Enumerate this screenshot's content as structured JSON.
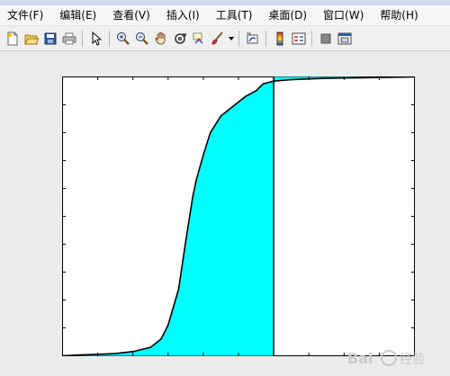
{
  "window": {
    "title_bar_color": "#cfdcec"
  },
  "menubar": {
    "items": [
      {
        "label": "文件(F)"
      },
      {
        "label": "编辑(E)"
      },
      {
        "label": "查看(V)"
      },
      {
        "label": "插入(I)"
      },
      {
        "label": "工具(T)"
      },
      {
        "label": "桌面(D)"
      },
      {
        "label": "窗口(W)"
      },
      {
        "label": "帮助(H)"
      }
    ]
  },
  "toolbar": {
    "icons": [
      "new-figure-icon",
      "open-file-icon",
      "save-icon",
      "print-icon",
      "select-arrow-icon",
      "zoom-in-icon",
      "zoom-out-icon",
      "pan-hand-icon",
      "rotate-3d-icon",
      "data-cursor-icon",
      "brush-icon",
      "brush-dropdown-icon",
      "link-plot-icon",
      "colorbar-icon",
      "legend-icon",
      "hide-plot-tools-icon",
      "show-plot-tools-icon"
    ]
  },
  "chart_data": {
    "type": "area",
    "description_free": true,
    "x": [
      0.0,
      0.05,
      0.1,
      0.15,
      0.2,
      0.25,
      0.28,
      0.3,
      0.33,
      0.35,
      0.37,
      0.38,
      0.4,
      0.42,
      0.45,
      0.48,
      0.5,
      0.52,
      0.55,
      0.57,
      0.6,
      0.61,
      0.63,
      0.65,
      0.7,
      0.75,
      0.8,
      0.85,
      0.9,
      0.95,
      1.0
    ],
    "y": [
      0.0,
      0.003,
      0.005,
      0.008,
      0.015,
      0.03,
      0.06,
      0.11,
      0.24,
      0.41,
      0.57,
      0.63,
      0.72,
      0.8,
      0.86,
      0.89,
      0.91,
      0.93,
      0.95,
      0.975,
      0.985,
      0.986,
      0.988,
      0.99,
      0.993,
      0.995,
      0.996,
      0.997,
      0.998,
      0.999,
      1.0
    ],
    "fill_region_x": [
      0.0,
      0.6
    ],
    "fill_region_upper_x": [
      0.6,
      1.0
    ],
    "divider_x": 0.6,
    "xlim": [
      0,
      1
    ],
    "ylim": [
      0,
      1
    ],
    "fill_color": "#00ffff",
    "line_color": "#000000",
    "grid": false,
    "title": "",
    "xlabel": "",
    "ylabel": ""
  },
  "watermark": {
    "text": "Bai 经验"
  }
}
